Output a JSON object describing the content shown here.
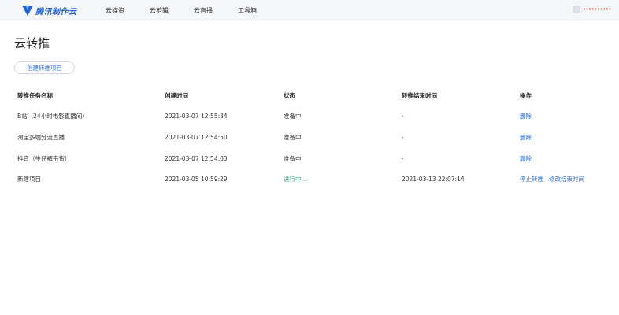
{
  "header": {
    "logo_text": "腾讯制作云",
    "nav": [
      "云媒资",
      "云剪辑",
      "云直播",
      "工具箱"
    ],
    "username": "••••••••••"
  },
  "page": {
    "title": "云转推",
    "create_label": "创建转推项目"
  },
  "table": {
    "columns": [
      "转推任务名称",
      "创建时间",
      "状态",
      "转推结束时间",
      "操作"
    ],
    "rows": [
      {
        "name": "B站（24小时电影直播间）",
        "created": "2021-03-07 12:55:34",
        "status": "准备中",
        "end": "-",
        "actions": [
          "删除"
        ]
      },
      {
        "name": "淘宝多端分流直播",
        "created": "2021-03-07 12:54:50",
        "status": "准备中",
        "end": "-",
        "actions": [
          "删除"
        ]
      },
      {
        "name": "抖音（牛仔裤带货）",
        "created": "2021-03-07 12:54:03",
        "status": "准备中",
        "end": "-",
        "actions": [
          "删除"
        ]
      },
      {
        "name": "新建项目",
        "created": "2021-03-05 10:59:29",
        "status": "进行中...",
        "end": "2021-03-13 22:07:14",
        "actions": [
          "停止转推",
          "修改结束时间"
        ]
      }
    ]
  },
  "colors": {
    "accent": "#2b6de0",
    "status_active": "#19a974",
    "logo": "#1d64d8"
  }
}
